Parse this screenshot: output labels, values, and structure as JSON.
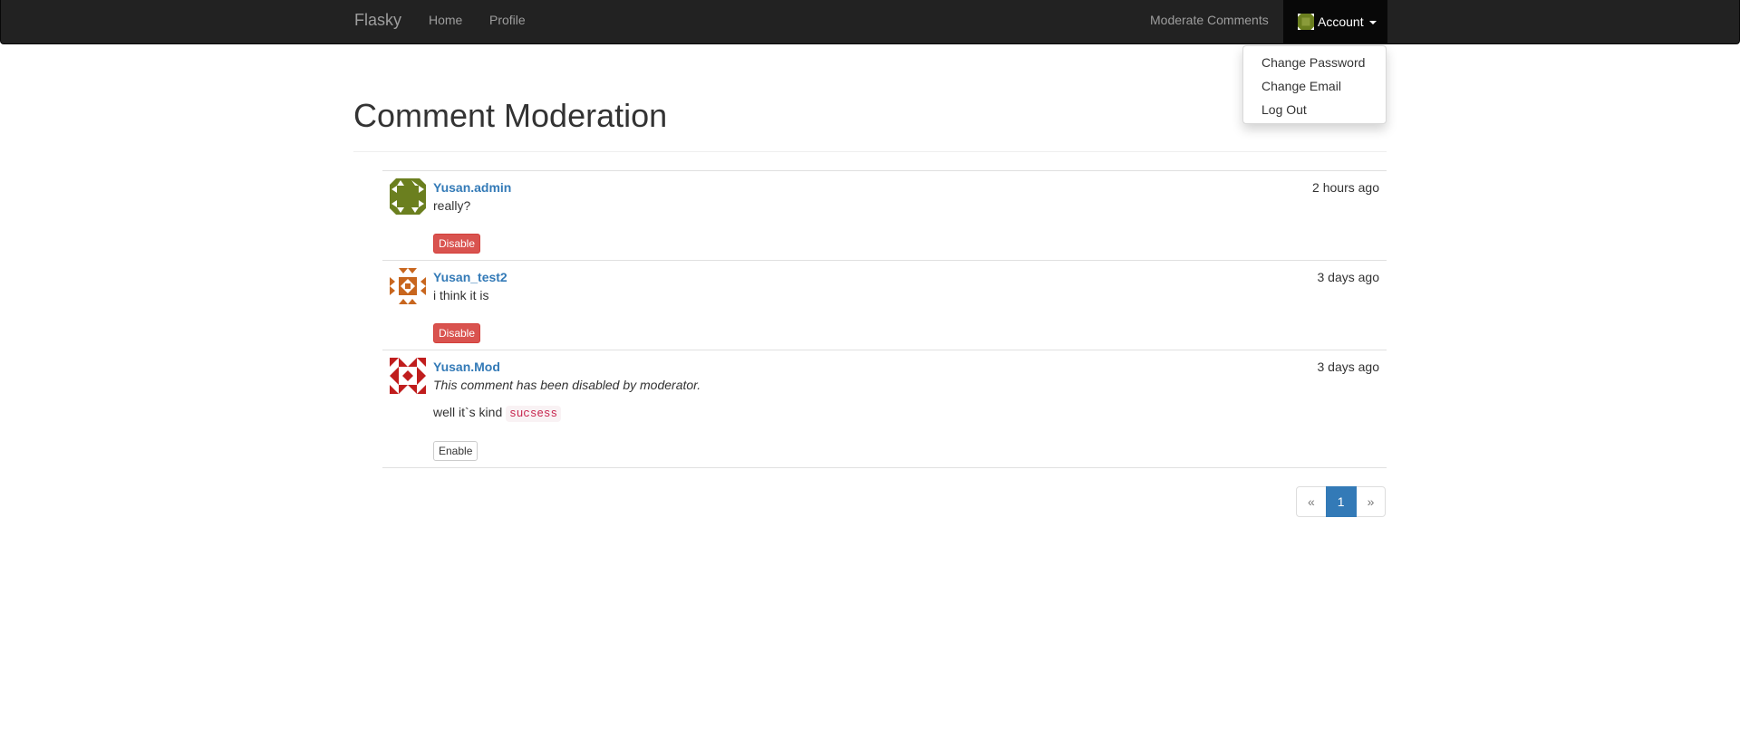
{
  "navbar": {
    "brand": "Flasky",
    "links": {
      "home": "Home",
      "profile": "Profile",
      "moderate": "Moderate Comments"
    },
    "account": {
      "label": "Account",
      "menu": [
        "Change Password",
        "Change Email",
        "Log Out"
      ]
    }
  },
  "page": {
    "title": "Comment Moderation"
  },
  "comments": [
    {
      "author": "Yusan.admin",
      "date": "2 hours ago",
      "body": "really?",
      "button": "Disable",
      "avatar_color": "#6b7f1f"
    },
    {
      "author": "Yusan_test2",
      "date": "3 days ago",
      "body": "i think it is",
      "button": "Disable",
      "avatar_color": "#c8661e"
    },
    {
      "author": "Yusan.Mod",
      "date": "3 days ago",
      "disabled_note": "This comment has been disabled by moderator.",
      "body": "well it`s kind ",
      "code": "sucsess",
      "button": "Enable",
      "avatar_color": "#c01d1d"
    }
  ],
  "pagination": {
    "prev": "«",
    "current": "1",
    "next": "»"
  },
  "colors": {
    "link": "#337ab7",
    "danger": "#d9534f",
    "navbar": "#222222"
  }
}
